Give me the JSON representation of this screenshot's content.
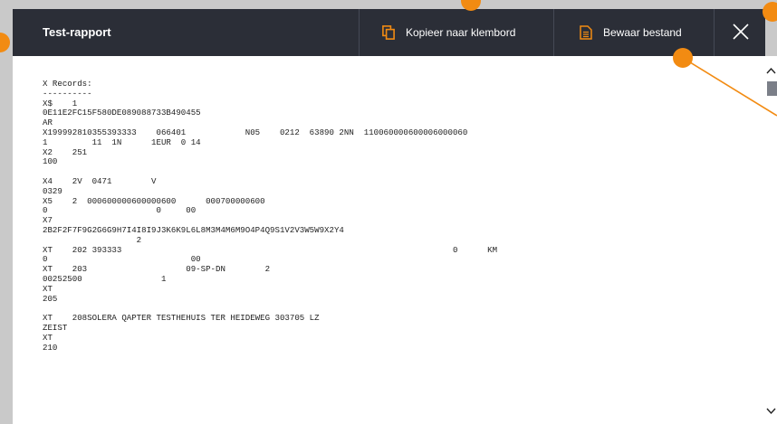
{
  "header": {
    "title": "Test-rapport",
    "copy_label": "Kopieer naar klembord",
    "save_label": "Bewaar bestand"
  },
  "report": {
    "lines": [
      "X Records:",
      "----------",
      "X$    1",
      "0E11E2FC15F580DE089088733B490455",
      "AR",
      "X199992810355393333    066401            N05    0212  63890 2NN  110060000600006000060",
      "1         11  1N      1EUR  0 14",
      "X2    251",
      "100",
      "",
      "X4    2V  0471        V",
      "0329",
      "X5    2  000600000600000600      000700000600",
      "0                      0     00",
      "X7",
      "2B2F2F7F9G2G6G9H7I4I8I9J3K6K9L6L8M3M4M6M9O4P4Q9S1V2V3W5W9X2Y4",
      "                   2",
      "XT    202 393333                                                                   0      KM",
      "0                             00",
      "XT    203                    09-SP-DN        2",
      "00252500                1",
      "XT",
      "205",
      "",
      "XT    208SOLERA QAPTER TESTHEHUIS TER HEIDEWEG 303705 LZ",
      "ZEIST",
      "XT",
      "210"
    ]
  },
  "colors": {
    "header_bg": "#2b2e37",
    "accent": "#f28b12",
    "overlay": "#c9c9c9"
  },
  "icons": {
    "copy": "copy-icon",
    "save": "file-icon",
    "close": "close-icon"
  }
}
